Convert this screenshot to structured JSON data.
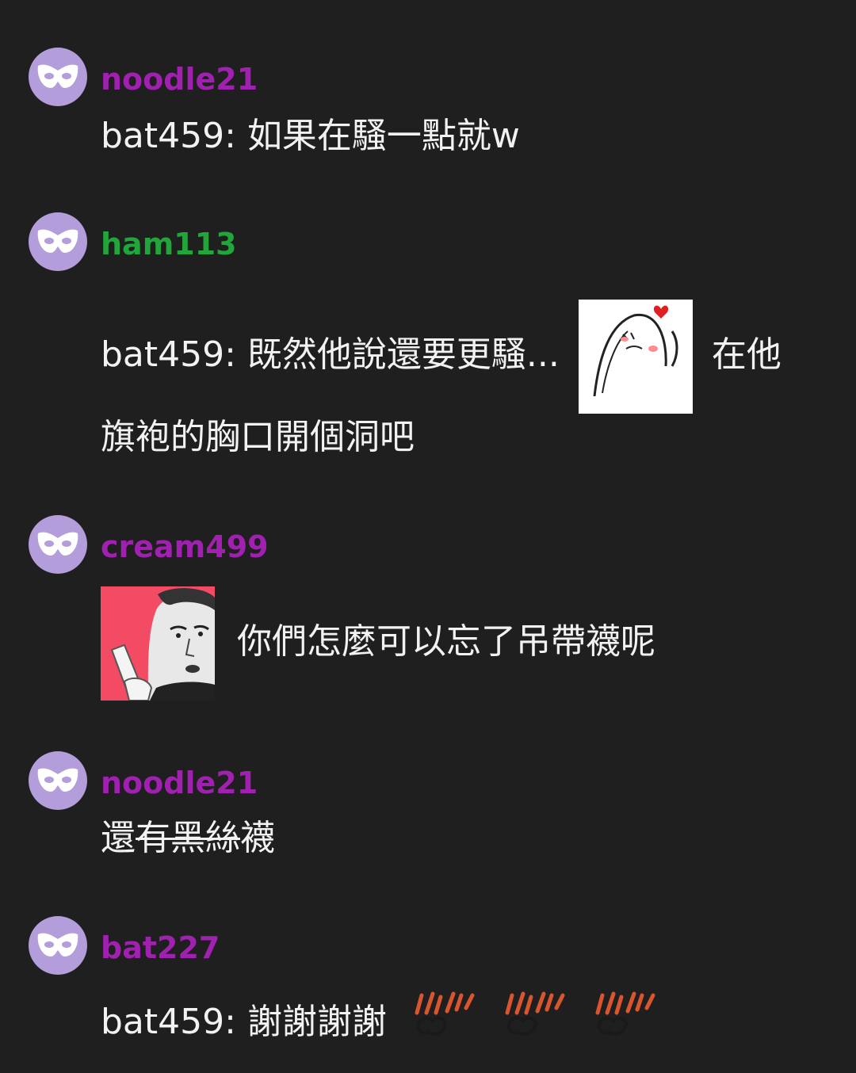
{
  "theme": {
    "background": "#1f1f1f",
    "avatar_bg": "#b39ddb",
    "text_color": "#f2f2f2",
    "user_colors": {
      "purple": "#a020b0",
      "green": "#22a53a"
    }
  },
  "messages": [
    {
      "username": "noodle21",
      "avatar_icon": "mask-icon",
      "line1": "bat459: 如果在騷一點就w"
    },
    {
      "username": "ham113",
      "avatar_icon": "mask-icon",
      "line1_before": "bat459: 既然他說還要更騷...",
      "sticker": "blushing-ghost-heart-sticker",
      "line1_after": "在他",
      "line2": "旗袍的胸口開個洞吧"
    },
    {
      "username": "cream499",
      "avatar_icon": "mask-icon",
      "sticker": "pointing-man-sticker",
      "line1": "你們怎麼可以忘了吊帶襪呢"
    },
    {
      "username": "noodle21",
      "avatar_icon": "mask-icon",
      "line1_plain": "還",
      "line1_strike": "有黑絲",
      "line1_end": "襪"
    },
    {
      "username": "bat227",
      "avatar_icon": "mask-icon",
      "line1": "bat459: 謝謝謝謝",
      "reactions": [
        "clapping-hands-icon",
        "clapping-hands-icon",
        "clapping-hands-icon"
      ]
    }
  ]
}
